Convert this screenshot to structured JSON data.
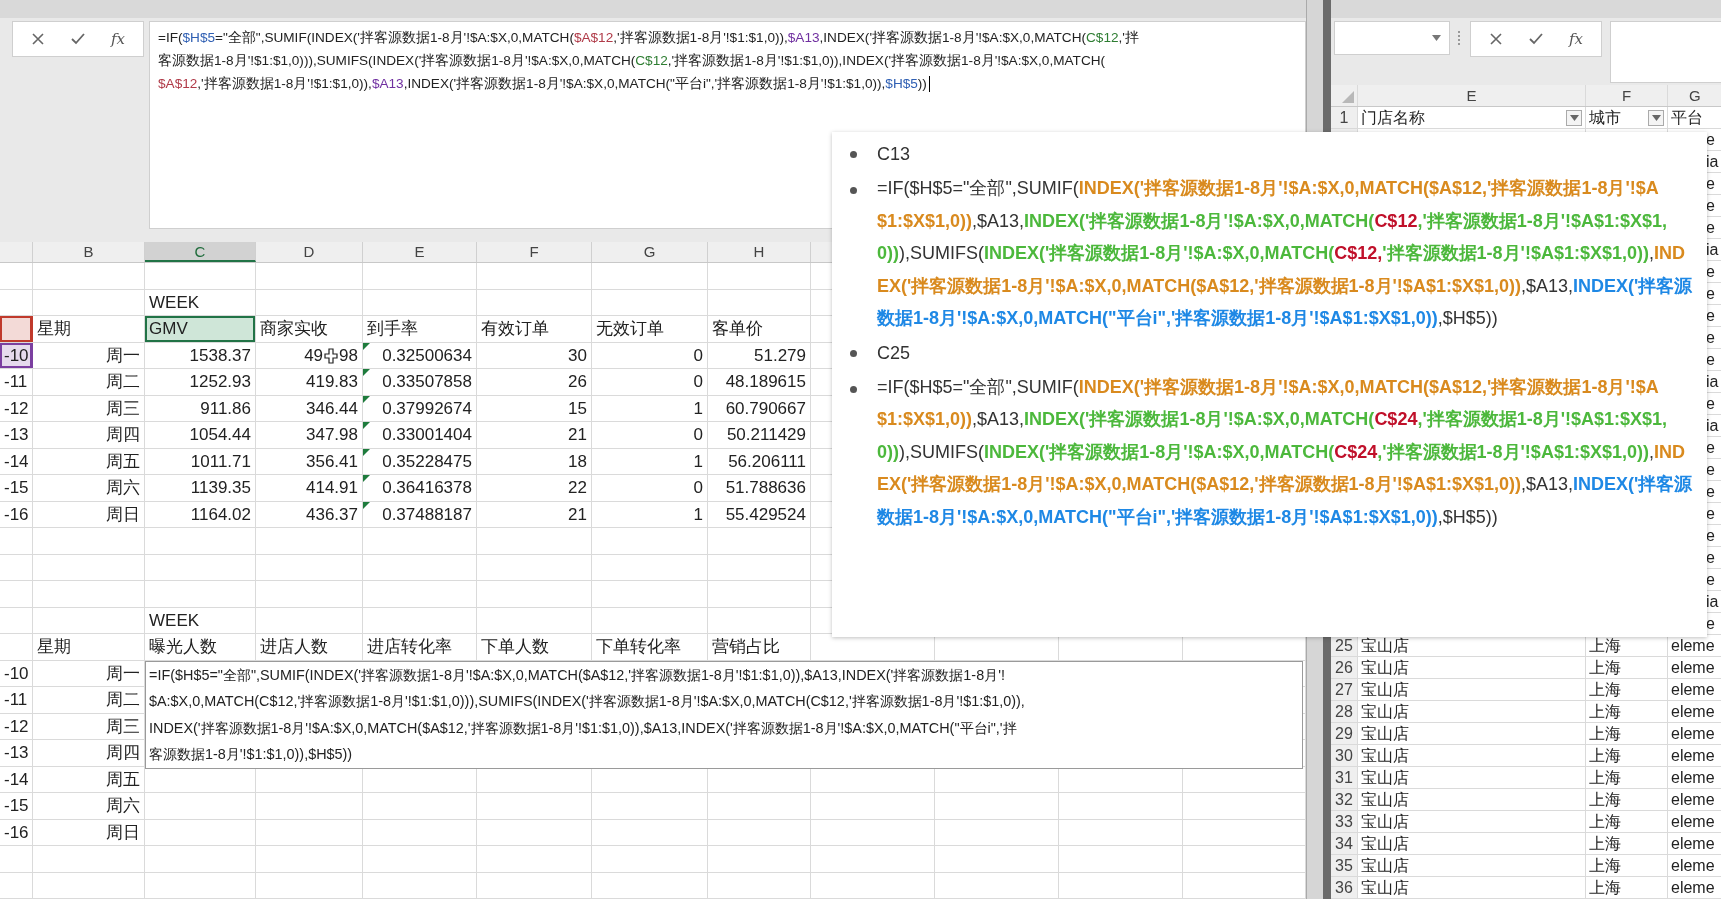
{
  "formula_bar": {
    "fx": "fx",
    "lines": [
      [
        {
          "t": "=IF("
        },
        {
          "t": "$H$5",
          "color": "#2f5fb3"
        },
        {
          "t": "=\"全部\",SUMIF(INDEX('拌客源数据1-8月'!$A:$X,0,MATCH("
        },
        {
          "t": "$A$12",
          "color": "#b03a48"
        },
        {
          "t": ",'拌客源数据1-8月'!$1:$1,0)),"
        },
        {
          "t": "$A13",
          "color": "#7030a0"
        },
        {
          "t": ",INDEX('拌客源数据1-8月'!$A:$X,0,MATCH("
        },
        {
          "t": "C$12",
          "color": "#2e7d32"
        },
        {
          "t": ",'拌"
        }
      ],
      [
        {
          "t": "客源数据1-8月'!$1:$1,0))),SUMIFS(INDEX('拌客源数据1-8月'!$A:$X,0,MATCH("
        },
        {
          "t": "C$12",
          "color": "#2e7d32"
        },
        {
          "t": ",'拌客源数据1-8月'!$1:$1,0)),INDEX('拌客源数据1-8月'!$A:$X,0,MATCH("
        }
      ],
      [
        {
          "t": "$A$12",
          "color": "#b03a48"
        },
        {
          "t": ",'拌客源数据1-8月'!$1:$1,0)),"
        },
        {
          "t": "$A13",
          "color": "#7030a0"
        },
        {
          "t": ",INDEX('拌客源数据1-8月'!$A:$X,0,MATCH(\"平台i\",'拌客源数据1-8月'!$1:$1,0)),"
        },
        {
          "t": "$H$5",
          "color": "#2f5fb3"
        },
        {
          "t": "))"
        }
      ]
    ]
  },
  "columns": [
    {
      "label": "B",
      "selected": false
    },
    {
      "label": "C",
      "selected": true
    },
    {
      "label": "D",
      "selected": false
    },
    {
      "label": "E",
      "selected": false
    },
    {
      "label": "F",
      "selected": false
    },
    {
      "label": "G",
      "selected": false
    },
    {
      "label": "H",
      "selected": false
    }
  ],
  "sections": [
    {
      "week": "WEEK",
      "header": {
        "color": "#c0392b",
        "b": "星期",
        "cells": [
          {
            "text": "GMV",
            "selected": true
          },
          {
            "text": "商家实收",
            "selected": false
          },
          {
            "text": "到手率",
            "selected": false
          },
          {
            "text": "有效订单",
            "selected": false
          },
          {
            "text": "无效订单",
            "selected": false
          },
          {
            "text": "客单价",
            "selected": false
          }
        ]
      },
      "rows": [
        {
          "a": "-10",
          "color": "#7b3fa0",
          "b": "周一",
          "cells": [
            "1538.37",
            {
              "text": "49",
              "tail": "98"
            },
            {
              "text": "0.32500634",
              "warning": true
            },
            "30",
            "0",
            "51.279"
          ]
        },
        {
          "a": "-11",
          "b": "周二",
          "cells": [
            "1252.93",
            "419.83",
            {
              "text": "0.33507858",
              "warning": true
            },
            "26",
            "0",
            "48.189615"
          ]
        },
        {
          "a": "-12",
          "b": "周三",
          "cells": [
            "911.86",
            "346.44",
            {
              "text": "0.37992674",
              "warning": true
            },
            "15",
            "1",
            "60.790667"
          ]
        },
        {
          "a": "-13",
          "b": "周四",
          "cells": [
            "1054.44",
            "347.98",
            {
              "text": "0.33001404",
              "warning": true
            },
            "21",
            "0",
            "50.211429"
          ]
        },
        {
          "a": "-14",
          "b": "周五",
          "cells": [
            "1011.71",
            "356.41",
            {
              "text": "0.35228475",
              "warning": true
            },
            "18",
            "1",
            "56.206111"
          ]
        },
        {
          "a": "-15",
          "b": "周六",
          "cells": [
            "1139.35",
            "414.91",
            {
              "text": "0.36416378",
              "warning": true
            },
            "22",
            "0",
            "51.788636"
          ]
        },
        {
          "a": "-16",
          "b": "周日",
          "cells": [
            "1164.02",
            "436.37",
            {
              "text": "0.37488187",
              "warning": true
            },
            "21",
            "1",
            "55.429524"
          ]
        }
      ]
    },
    {
      "week": "WEEK",
      "header": {
        "b": "星期",
        "cells": [
          {
            "text": "曝光人数",
            "selected": false
          },
          {
            "text": "进店人数",
            "selected": false
          },
          {
            "text": "进店转化率",
            "selected": false
          },
          {
            "text": "下单人数",
            "selected": false
          },
          {
            "text": "下单转化率",
            "selected": false
          },
          {
            "text": "营销占比",
            "selected": false
          }
        ]
      },
      "rows": [
        {
          "a": "-10",
          "b": "周一",
          "cells": []
        },
        {
          "a": "-11",
          "b": "周二",
          "cells": []
        },
        {
          "a": "-12",
          "b": "周三",
          "cells": []
        },
        {
          "a": "-13",
          "b": "周四",
          "cells": []
        },
        {
          "a": "-14",
          "b": "周五",
          "cells": []
        },
        {
          "a": "-15",
          "b": "周六",
          "cells": []
        },
        {
          "a": "-16",
          "b": "周日",
          "cells": []
        }
      ],
      "editor": {
        "lines": [
          "=IF($H$5=\"全部\",SUMIF(INDEX('拌客源数据1-8月'!$A:$X,0,MATCH($A$12,'拌客源数据1-8月'!$1:$1,0)),$A13,INDEX('拌客源数据1-8月'!",
          "$A:$X,0,MATCH(C$12,'拌客源数据1-8月'!$1:$1,0))),SUMIFS(INDEX('拌客源数据1-8月'!$A:$X,0,MATCH(C$12,'拌客源数据1-8月'!$1:$1,0)),",
          "INDEX('拌客源数据1-8月'!$A:$X,0,MATCH($A$12,'拌客源数据1-8月'!$1:$1,0)),$A13,INDEX('拌客源数据1-8月'!$A:$X,0,MATCH(\"平台i\",'拌",
          "客源数据1-8月'!$1:$1,0)),$H$5))"
        ]
      }
    }
  ],
  "side_sheet": {
    "fx": "fx",
    "columns": [
      "E",
      "F",
      "G"
    ],
    "header": {
      "row": "1",
      "cells": [
        {
          "text": "门店名称",
          "filter": true
        },
        {
          "text": "城市",
          "filter": true
        },
        {
          "text": "平台"
        }
      ]
    },
    "fragments": [
      "e",
      "ia",
      "e",
      "e",
      "e",
      "ia",
      "e",
      "e",
      "e",
      "e",
      "e",
      "ia",
      "e",
      "ia",
      "e",
      "e",
      "e",
      "e",
      "e",
      "e",
      "e",
      "ia",
      "e"
    ],
    "rows": [
      {
        "row": "25",
        "store": "宝山店",
        "city": "上海",
        "platform": "eleme"
      },
      {
        "row": "26",
        "store": "宝山店",
        "city": "上海",
        "platform": "eleme"
      },
      {
        "row": "27",
        "store": "宝山店",
        "city": "上海",
        "platform": "eleme"
      },
      {
        "row": "28",
        "store": "宝山店",
        "city": "上海",
        "platform": "eleme"
      },
      {
        "row": "29",
        "store": "宝山店",
        "city": "上海",
        "platform": "eleme"
      },
      {
        "row": "30",
        "store": "宝山店",
        "city": "上海",
        "platform": "eleme"
      },
      {
        "row": "31",
        "store": "宝山店",
        "city": "上海",
        "platform": "eleme"
      },
      {
        "row": "32",
        "store": "宝山店",
        "city": "上海",
        "platform": "eleme"
      },
      {
        "row": "33",
        "store": "宝山店",
        "city": "上海",
        "platform": "eleme"
      },
      {
        "row": "34",
        "store": "宝山店",
        "city": "上海",
        "platform": "eleme"
      },
      {
        "row": "35",
        "store": "宝山店",
        "city": "上海",
        "platform": "eleme"
      },
      {
        "row": "36",
        "store": "宝山店",
        "city": "上海",
        "platform": "eleme"
      }
    ]
  },
  "note": {
    "items": [
      {
        "kind": "label",
        "text": "C13"
      },
      {
        "kind": "formula",
        "segments": [
          {
            "t": "=IF($H$5=\"全部\",SUMIF("
          },
          {
            "t": "INDEX('拌客源数据1-8月'!$A:$X,0,MATCH($A$12,'拌客源数据1-8月'!$A$1:$X$1,0))",
            "color": "#d98a1e"
          },
          {
            "t": ",$A13,"
          },
          {
            "t": "INDEX('拌客源数据1-8月'!$A:$X,0,MATCH(",
            "color": "#4cb83c"
          },
          {
            "t": "C$12",
            "color": "#c0102a"
          },
          {
            "t": ",'拌客源数据1-8月'!$A$1:$X$1,0))",
            "color": "#4cb83c"
          },
          {
            "t": "),SUMIFS("
          },
          {
            "t": "INDEX('拌客源数据1-8月'!$A:$X,0,MATCH(",
            "color": "#4cb83c"
          },
          {
            "t": "C$12,",
            "color": "#c0102a"
          },
          {
            "t": "'拌客源数据1-8月'!$A$1:$X$1,0))",
            "color": "#4cb83c"
          },
          {
            "t": ","
          },
          {
            "t": "INDEX('拌客源数据1-8月'!$A:$X,0,MATCH($A$12,'拌客源数据1-8月'!$A$1:$X$1,0))",
            "color": "#d98a1e"
          },
          {
            "t": ",$A13,"
          },
          {
            "t": "INDEX('拌客源数据1-8月'!$A:$X,0,MATCH(\"平台i\",'拌客源数据1-8月'!$A$1:$X$1,0))",
            "color": "#1e88e5"
          },
          {
            "t": ",$H$5))"
          }
        ]
      },
      {
        "kind": "label",
        "text": "C25"
      },
      {
        "kind": "formula",
        "segments": [
          {
            "t": "=IF($H$5=\"全部\",SUMIF("
          },
          {
            "t": "INDEX('拌客源数据1-8月'!$A:$X,0,MATCH($A$12,'拌客源数据1-8月'!$A$1:$X$1,0))",
            "color": "#d98a1e"
          },
          {
            "t": ",$A13,"
          },
          {
            "t": "INDEX('拌客源数据1-8月'!$A:$X,0,MATCH(",
            "color": "#4cb83c"
          },
          {
            "t": "C$24",
            "color": "#c0102a"
          },
          {
            "t": ",'拌客源数据1-8月'!$A$1:$X$1,0))",
            "color": "#4cb83c"
          },
          {
            "t": "),SUMIFS("
          },
          {
            "t": "INDEX('拌客源数据1-8月'!$A:$X,0,MATCH(",
            "color": "#4cb83c"
          },
          {
            "t": "C$24",
            "color": "#c0102a"
          },
          {
            "t": ",'拌客源数据1-8月'!$A$1:$X$1,0))",
            "color": "#4cb83c"
          },
          {
            "t": ","
          },
          {
            "t": "INDEX('拌客源数据1-8月'!$A:$X,0,MATCH($A$12,'拌客源数据1-8月'!$A$1:$X$1,0))",
            "color": "#d98a1e"
          },
          {
            "t": ",$A13,"
          },
          {
            "t": "INDEX('拌客源数据1-8月'!$A:$X,0,MATCH(\"平台i\",'拌客源数据1-8月'!$A$1:$X$1,0))",
            "color": "#1e88e5"
          },
          {
            "t": ",$H$5))"
          }
        ]
      }
    ]
  }
}
